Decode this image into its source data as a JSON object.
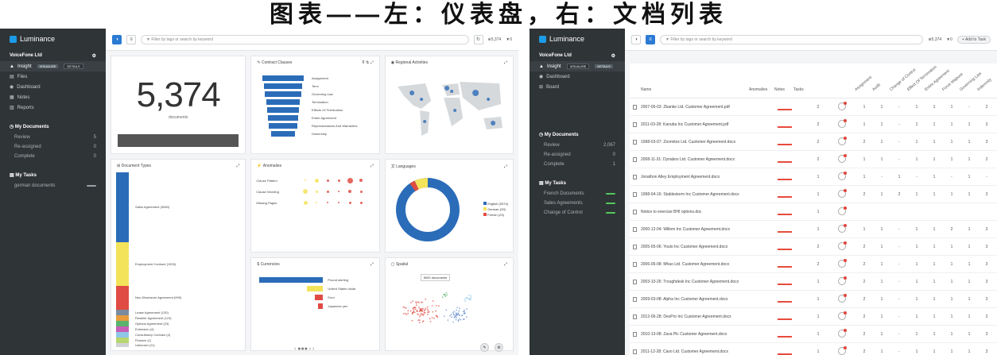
{
  "heading": "图表——左：仪表盘，右：文档列表",
  "left": {
    "app": "Luminance",
    "org": "VoiceFone Ltd",
    "nav": [
      {
        "label": "Insight",
        "active": true
      },
      {
        "label": "Files"
      },
      {
        "label": "Dashboard"
      },
      {
        "label": "Notes"
      },
      {
        "label": "Reports"
      }
    ],
    "pills": [
      "VISUALISE",
      "DETAILS"
    ],
    "my_documents": "My Documents",
    "doc_rows": [
      {
        "label": "Review",
        "count": "5"
      },
      {
        "label": "Re-assigned",
        "count": "0"
      },
      {
        "label": "Complete",
        "count": "0"
      }
    ],
    "my_tasks": "My Tasks",
    "task_rows": [
      {
        "label": "german documents"
      }
    ],
    "search_placeholder": "Filter by tags or search by keyword",
    "top_count": "5,374",
    "top_flags": "0",
    "kpi": {
      "value": "5,374",
      "label": "documents"
    },
    "cards": {
      "contract_clauses": "Contract Clauses",
      "regional": "Regional Activities",
      "doc_types": "Document Types",
      "anomalies": "Anomalies",
      "languages": "Languages",
      "currencies": "Currencies",
      "spatial": "Spatial"
    },
    "clauses": [
      "Assignment",
      "Term",
      "Governing Law",
      "Termination",
      "Effects Of Termination",
      "Entire Agreement",
      "Representations And Warranties",
      "Ownership"
    ],
    "doc_types": [
      "Sales Agreement (3080)",
      "Employment Contract (1005)",
      "Non-Disclosure Agreement (990)",
      "Lease Agreement (130)",
      "Reseller Agreement (123)",
      "Options Agreement (23)",
      "Extension (4)",
      "Consultancy Contract (4)",
      "Finance (1)",
      "Unknown (11)"
    ],
    "anomalies": [
      "Clause Pattern",
      "Clause Wording",
      "Missing Pages"
    ],
    "languages": [
      "English (5374)",
      "German (33)",
      "French (23)"
    ],
    "currencies": [
      "Pound sterling",
      "United States dollar",
      "Euro",
      "Japanese yen"
    ],
    "spatial_tip": "5000 documents",
    "pager": "‹ ●●● › ›",
    "colors": {
      "sidebar": "#2f3437",
      "blue": "#2b6cb8",
      "yellow": "#f3e35a",
      "red": "#e04b43",
      "accent": "#1c9be6"
    }
  },
  "right": {
    "app": "Luminance",
    "org": "VoiceFone Ltd",
    "nav": [
      {
        "label": "Insight",
        "active": true
      },
      {
        "label": "Dashboard"
      },
      {
        "label": "Board"
      }
    ],
    "pills": [
      "VISUALISE",
      "DETAILS"
    ],
    "my_documents": "My Documents",
    "doc_rows": [
      {
        "label": "Review",
        "count": "2,067"
      },
      {
        "label": "Re-assigned",
        "count": "0"
      },
      {
        "label": "Complete",
        "count": "1"
      }
    ],
    "my_tasks": "My Tasks",
    "task_rows": [
      {
        "label": "French Documents"
      },
      {
        "label": "Sales Agreements"
      },
      {
        "label": "Change of Control"
      }
    ],
    "search_placeholder": "Filter by tags or search by keyword",
    "top_count": "5,374",
    "top_flags": "0",
    "add_button": "+ Add to Task",
    "columns": [
      "Name",
      "Anomalies",
      "Notes",
      "Tasks",
      "Assignment",
      "Audit",
      "Change of Control",
      "Effect Of Termination",
      "Entire Agreement",
      "Force Majeure",
      "Governing Law",
      "Indemnity"
    ],
    "rows": [
      {
        "name": "2007-06-03: Zbanke Ltd. Customer Agreement.pdf",
        "notes": "2",
        "v": [
          "1",
          "1",
          "-",
          "1",
          "1",
          "1",
          "-",
          "2",
          "3"
        ]
      },
      {
        "name": "2011-03-28: Kanuba Inc Customer Agreement.pdf",
        "notes": "2",
        "v": [
          "1",
          "1",
          "-",
          "1",
          "1",
          "1",
          "1",
          "3",
          "3"
        ]
      },
      {
        "name": "1998-03-07: Zoomitox Ltd. Customer Agreement.docx",
        "notes": "2",
        "v": [
          "2",
          "1",
          "-",
          "1",
          "1",
          "1",
          "1",
          "3",
          "3"
        ]
      },
      {
        "name": "2008-11-31: Dynabox Ltd. Customer Agreement.docx",
        "notes": "2",
        "v": [
          "1",
          "1",
          "-",
          "1",
          "1",
          "1",
          "1",
          "2",
          "3"
        ]
      },
      {
        "name": "Jonathon Alley Employment Agreement.docx",
        "notes": "1",
        "v": [
          "1",
          "-",
          "1",
          "-",
          "1",
          "-",
          "1",
          "-",
          "-"
        ]
      },
      {
        "name": "1998-04-16: Stablestorm Inc Customer Agreement.docx",
        "notes": "1",
        "v": [
          "2",
          "1",
          "2",
          "1",
          "1",
          "1",
          "1",
          "3",
          "3"
        ]
      },
      {
        "name": "Notice to exercise BHI options.doc",
        "notes": "1",
        "v": [
          "",
          "",
          "",
          "",
          "",
          "",
          "",
          "",
          ""
        ]
      },
      {
        "name": "2000-12-04: Willem Inc Customer Agreement.docx",
        "notes": "1",
        "v": [
          "1",
          "1",
          "-",
          "1",
          "1",
          "2",
          "1",
          "3",
          "3"
        ]
      },
      {
        "name": "2005-05-06: Youlo Inc Customer Agreement.docx",
        "notes": "2",
        "v": [
          "2",
          "1",
          "-",
          "1",
          "1",
          "1",
          "1",
          "3",
          "3"
        ]
      },
      {
        "name": "2006-06-08: Mhao Ltd. Customer Agreement.docx",
        "notes": "2",
        "v": [
          "2",
          "1",
          "-",
          "1",
          "1",
          "1",
          "1",
          "3",
          "3"
        ]
      },
      {
        "name": "2003-10-26: Troughdesk Inc Customer Agreement.docx",
        "notes": "1",
        "v": [
          "2",
          "1",
          "-",
          "1",
          "1",
          "1",
          "1",
          "3",
          "3"
        ]
      },
      {
        "name": "2009-03-08: Alpha Inc Customer Agreement.docx",
        "notes": "1",
        "v": [
          "2",
          "1",
          "-",
          "1",
          "1",
          "1",
          "1",
          "3",
          "3"
        ]
      },
      {
        "name": "2012-06-28: DevPro Inc Customer Agreement.docx",
        "notes": "1",
        "v": [
          "2",
          "1",
          "-",
          "1",
          "1",
          "1",
          "1",
          "3",
          "3"
        ]
      },
      {
        "name": "2010-13-08: Zava Plc Customer Agreement.docx",
        "notes": "1",
        "v": [
          "2",
          "1",
          "-",
          "1",
          "1",
          "1",
          "1",
          "3",
          "3"
        ]
      },
      {
        "name": "2011-12-28: Cavo Ltd. Customer Agreement.docx",
        "notes": "1",
        "v": [
          "2",
          "1",
          "-",
          "1",
          "1",
          "1",
          "1",
          "3",
          "3"
        ]
      }
    ]
  }
}
